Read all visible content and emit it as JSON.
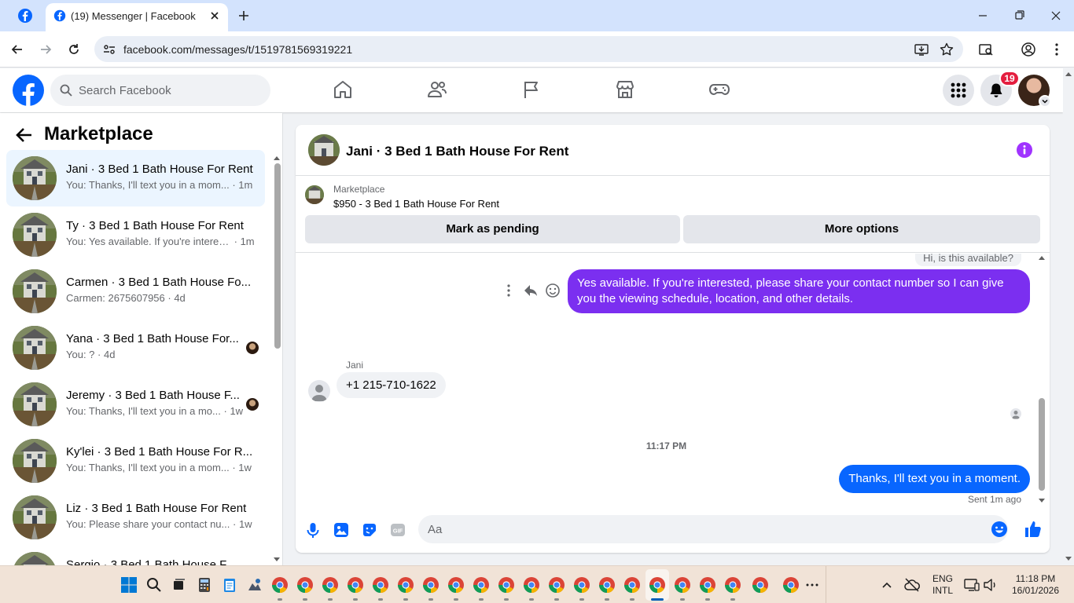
{
  "browser": {
    "tab_title": "(19) Messenger | Facebook",
    "url": "facebook.com/messages/t/1519781569319221",
    "icons": [
      "facebook-favicon",
      "close-icon",
      "new-tab-icon",
      "minimize-icon",
      "maximize-icon",
      "window-close-icon",
      "back-icon",
      "forward-icon",
      "reload-icon",
      "site-info-icon",
      "install-app-icon",
      "bookmark-star-icon",
      "tab-search-icon",
      "profile-icon",
      "kebab-menu-icon"
    ]
  },
  "fb": {
    "search_placeholder": "Search Facebook",
    "notifications_count": "19",
    "nav_icons": [
      "home-icon",
      "friends-icon",
      "pages-flag-icon",
      "marketplace-icon",
      "gaming-icon"
    ]
  },
  "sidebar": {
    "title": "Marketplace",
    "conversations": [
      {
        "name": "Jani · 3 Bed 1 Bath House For Rent",
        "snippet": "You: Thanks, I'll text you in a mom...",
        "time": "1m",
        "active": true
      },
      {
        "name": "Ty · 3 Bed 1 Bath House For Rent",
        "snippet": "You: Yes available. If you're interest...",
        "time": "1m",
        "active": false
      },
      {
        "name": "Carmen · 3 Bed 1 Bath House Fo...",
        "snippet": "Carmen: 2675607956",
        "time": "4d",
        "active": false
      },
      {
        "name": "Yana · 3 Bed 1 Bath House For...",
        "snippet": "You: ?",
        "time": "4d",
        "active": false,
        "seen_avatar": true
      },
      {
        "name": "Jeremy · 3 Bed 1 Bath House F...",
        "snippet": "You: Thanks, I'll text you in a mo...",
        "time": "1w",
        "active": false,
        "seen_avatar": true
      },
      {
        "name": "Ky'lei · 3 Bed 1 Bath House For R...",
        "snippet": "You: Thanks, I'll text you in a mom...",
        "time": "1w",
        "active": false
      },
      {
        "name": "Liz · 3 Bed 1 Bath House For Rent",
        "snippet": "You: Please share your contact nu...",
        "time": "1w",
        "active": false
      },
      {
        "name": "Sergio · 3 Bed 1 Bath House F...",
        "snippet": "",
        "time": "",
        "active": false
      }
    ]
  },
  "chat": {
    "title": "Jani · 3 Bed 1 Bath House For Rent",
    "marketplace_label": "Marketplace",
    "listing": "$950 - 3 Bed 1 Bath House For Rent",
    "btn_pending": "Mark as pending",
    "btn_more": "More options",
    "prev_message": "Hi, is this available?",
    "msg_out_1": "Yes available. If you're interested, please share your contact number so I can give you the viewing schedule, location, and other details.",
    "sender_name": "Jani",
    "msg_in_1": "+1 215-710-1622",
    "timestamp": "11:17 PM",
    "msg_out_2": "Thanks, I'll text you in a moment.",
    "sent_status": "Sent 1m ago",
    "composer_placeholder": "Aa"
  },
  "taskbar": {
    "lang_line1": "ENG",
    "lang_line2": "INTL",
    "time": "11:18 PM",
    "date": "16/01/2026"
  },
  "colors": {
    "fb_blue": "#0866ff",
    "purple_bubble": "#7b2ff0",
    "info_purple": "#a033ff",
    "badge_red": "#e41e3f"
  }
}
